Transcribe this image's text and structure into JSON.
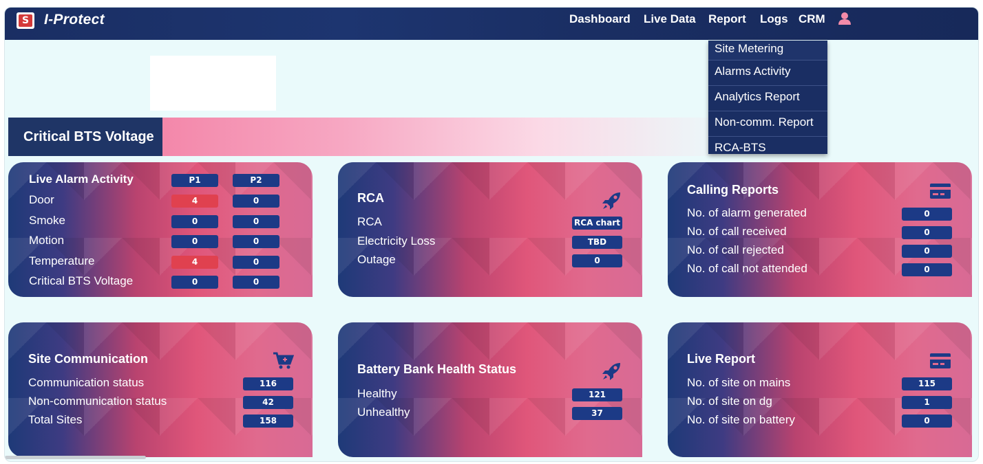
{
  "app": {
    "brand": "I-Protect",
    "logo_letter": "S"
  },
  "nav": {
    "items": [
      "Dashboard",
      "Live Data",
      "Report",
      "Logs",
      "CRM"
    ]
  },
  "report_menu": {
    "items": [
      "Site Metering",
      "Alarms Activity",
      "Analytics Report",
      "Non-comm. Report",
      "RCA-BTS"
    ]
  },
  "section": {
    "title": "Critical BTS Voltage"
  },
  "live_alarm": {
    "title": "Live Alarm Activity",
    "col1": "P1",
    "col2": "P2",
    "rows": [
      {
        "label": "Door",
        "p1": "4",
        "p2": "0"
      },
      {
        "label": "Smoke",
        "p1": "0",
        "p2": "0"
      },
      {
        "label": "Motion",
        "p1": "0",
        "p2": "0"
      },
      {
        "label": "Temperature",
        "p1": "4",
        "p2": "0"
      },
      {
        "label": "Critical BTS Voltage",
        "p1": "0",
        "p2": "0"
      }
    ]
  },
  "rca": {
    "title": "RCA",
    "rows": [
      {
        "label": "RCA",
        "value": "RCA chart"
      },
      {
        "label": "Electricity Loss",
        "value": "TBD"
      },
      {
        "label": "Outage",
        "value": "0"
      }
    ]
  },
  "calling": {
    "title": "Calling Reports",
    "rows": [
      {
        "label": "No. of alarm generated",
        "value": "0"
      },
      {
        "label": "No. of call received",
        "value": "0"
      },
      {
        "label": "No. of call rejected",
        "value": "0"
      },
      {
        "label": "No. of call not attended",
        "value": "0"
      }
    ]
  },
  "site_comm": {
    "title": "Site Communication",
    "rows": [
      {
        "label": "Communication status",
        "value": "116"
      },
      {
        "label": "Non-communication status",
        "value": "42"
      },
      {
        "label": "Total Sites",
        "value": "158"
      }
    ]
  },
  "battery": {
    "title": "Battery Bank Health Status",
    "rows": [
      {
        "label": "Healthy",
        "value": "121"
      },
      {
        "label": "Unhealthy",
        "value": "37"
      }
    ]
  },
  "live_report": {
    "title": "Live Report",
    "rows": [
      {
        "label": "No. of site on mains",
        "value": "115"
      },
      {
        "label": "No. of site on dg",
        "value": "1"
      },
      {
        "label": "No. of site on battery",
        "value": "0"
      }
    ]
  },
  "colors": {
    "topbar": "#1a2e63",
    "pill": "#1c3a86",
    "pill_alert": "#e0414f",
    "user_icon": "#f38ba8"
  },
  "icons": [
    "user-icon",
    "rocket-icon",
    "card-icon",
    "cart-icon"
  ]
}
